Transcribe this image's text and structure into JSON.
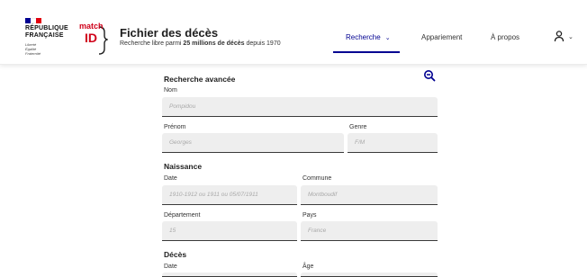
{
  "header": {
    "republic_name_line1": "RÉPUBLIQUE",
    "republic_name_line2": "FRANÇAISE",
    "motto": [
      "Liberté",
      "Égalité",
      "Fraternité"
    ],
    "brand_line1": "match",
    "brand_line2": "ID",
    "title": "Fichier des décès",
    "subtitle_prefix": "Recherche libre parmi ",
    "subtitle_highlight": "25 millions de décès",
    "subtitle_suffix": " depuis 1970"
  },
  "nav": {
    "items": [
      {
        "label": "Recherche",
        "active": true
      },
      {
        "label": "Appariement",
        "active": false
      },
      {
        "label": "À propos",
        "active": false
      }
    ],
    "user_icon": "user-icon",
    "chevron": "chevron-down-icon"
  },
  "form": {
    "title": "Recherche avancée",
    "collapse_icon": "zoom-out-icon",
    "nom": {
      "label": "Nom",
      "placeholder": "Pompidou"
    },
    "prenom": {
      "label": "Prénom",
      "placeholder": "Georges"
    },
    "genre": {
      "label": "Genre",
      "placeholder": "F/M"
    },
    "naissance": {
      "title": "Naissance",
      "date": {
        "label": "Date",
        "placeholder": "1910-1912 ou 1911 ou 05/07/1911"
      },
      "commune": {
        "label": "Commune",
        "placeholder": "Montboudif"
      },
      "departement": {
        "label": "Département",
        "placeholder": "15"
      },
      "pays": {
        "label": "Pays",
        "placeholder": "France"
      }
    },
    "deces": {
      "title": "Décès",
      "date": {
        "label": "Date"
      },
      "age": {
        "label": "Âge"
      }
    }
  },
  "colors": {
    "accent": "#000091",
    "marianne_red": "#e1000f",
    "field_bg": "#eeeeee"
  }
}
